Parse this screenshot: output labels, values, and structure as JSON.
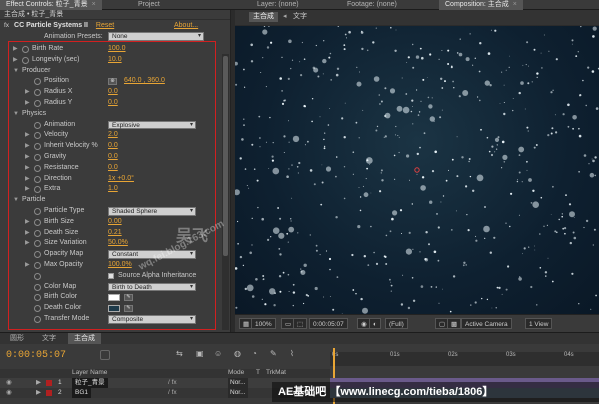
{
  "top_tabs": {
    "effect_controls": "Effect Controls: 粒子_青景",
    "project": "Project",
    "layer": "Layer: (none)",
    "footage": "Footage: (none)",
    "composition": "Composition: 主合成"
  },
  "ec": {
    "breadcrumb": "主合成 • 粒子_青景",
    "effect_name": "CC Particle Systems II",
    "reset": "Reset",
    "about": "About...",
    "presets_label": "Animation Presets:",
    "presets_value": "None",
    "rows": [
      {
        "label": "Birth Rate",
        "value": "100.0",
        "kind": "val",
        "indent": 1,
        "twirl": true,
        "sw": true
      },
      {
        "label": "Longevity (sec)",
        "value": "10.0",
        "kind": "val",
        "indent": 1,
        "twirl": true,
        "sw": true
      },
      {
        "label": "Producer",
        "kind": "group",
        "indent": 1
      },
      {
        "label": "Position",
        "value": "640.0 , 360.0",
        "kind": "pos",
        "indent": 2,
        "sw": true
      },
      {
        "label": "Radius X",
        "value": "0.0",
        "kind": "val",
        "indent": 2,
        "twirl": true,
        "sw": true
      },
      {
        "label": "Radius Y",
        "value": "0.0",
        "kind": "val",
        "indent": 2,
        "twirl": true,
        "sw": true
      },
      {
        "label": "Physics",
        "kind": "group",
        "indent": 1
      },
      {
        "label": "Animation",
        "value": "Explosive",
        "kind": "dd",
        "indent": 2,
        "sw": true
      },
      {
        "label": "Velocity",
        "value": "2.0",
        "kind": "val",
        "indent": 2,
        "twirl": true,
        "sw": true
      },
      {
        "label": "Inherit Velocity %",
        "value": "0.0",
        "kind": "val",
        "indent": 2,
        "twirl": true,
        "sw": true
      },
      {
        "label": "Gravity",
        "value": "0.0",
        "kind": "val",
        "indent": 2,
        "twirl": true,
        "sw": true
      },
      {
        "label": "Resistance",
        "value": "0.0",
        "kind": "val",
        "indent": 2,
        "twirl": true,
        "sw": true
      },
      {
        "label": "Direction",
        "value": "1x +0.0°",
        "kind": "val",
        "indent": 2,
        "twirl": true,
        "sw": true
      },
      {
        "label": "Extra",
        "value": "1.0",
        "kind": "val",
        "indent": 2,
        "twirl": true,
        "sw": true
      },
      {
        "label": "Particle",
        "kind": "group",
        "indent": 1
      },
      {
        "label": "Particle Type",
        "value": "Shaded Sphere",
        "kind": "dd",
        "indent": 2,
        "sw": true
      },
      {
        "label": "Birth Size",
        "value": "0.00",
        "kind": "val",
        "indent": 2,
        "twirl": true,
        "sw": true
      },
      {
        "label": "Death Size",
        "value": "0.21",
        "kind": "val",
        "indent": 2,
        "twirl": true,
        "sw": true
      },
      {
        "label": "Size Variation",
        "value": "50.0%",
        "kind": "val",
        "indent": 2,
        "twirl": true,
        "sw": true
      },
      {
        "label": "Opacity Map",
        "value": "Constant",
        "kind": "dd",
        "indent": 2,
        "sw": true
      },
      {
        "label": "Max Opacity",
        "value": "100.0%",
        "kind": "val",
        "indent": 2,
        "twirl": true,
        "sw": true
      },
      {
        "label": "",
        "value": "Source Alpha Inheritance",
        "kind": "chk",
        "indent": 2,
        "sw": true
      },
      {
        "label": "Color Map",
        "value": "Birth to Death",
        "kind": "dd",
        "indent": 2,
        "sw": true
      },
      {
        "label": "Birth Color",
        "value": "",
        "kind": "color",
        "color": "#ffffff",
        "indent": 2,
        "sw": true
      },
      {
        "label": "Death Color",
        "value": "",
        "kind": "color",
        "color": "#1e3a4a",
        "indent": 2,
        "sw": true
      },
      {
        "label": "Transfer Mode",
        "value": "Composite",
        "kind": "dd",
        "indent": 2,
        "sw": true
      }
    ]
  },
  "viewer": {
    "tab_main": "主合成",
    "tab_text": "文字",
    "zoom": "100%",
    "timecode": "0:00:05:07",
    "resolution": "(Full)",
    "camera": "Active Camera",
    "view": "1 View"
  },
  "timeline": {
    "tabs": [
      "圆形",
      "文字",
      "主合成"
    ],
    "timecode": "0:00:05:07",
    "col_layer_name": "Layer Name",
    "col_mode": "Mode",
    "col_t": "T",
    "col_trkmat": "TrkMat",
    "ruler": [
      "0s",
      "01s",
      "02s",
      "03s",
      "04s"
    ],
    "layers": [
      {
        "num": "1",
        "name": "粒子_青景",
        "mode": "Nor...",
        "color": "#b02020"
      },
      {
        "num": "2",
        "name": "BG1",
        "mode": "Nor...",
        "trkmat": "None",
        "color": "#b02020"
      }
    ]
  },
  "watermarks": {
    "banner": "AE基础吧 【www.linecg.com/tieba/1806】",
    "diag": "wq.fei.blog.163.com",
    "big": "吴飞"
  },
  "colors": {
    "accent": "#e8a535",
    "highlight_box": "#d12020",
    "bg": "#3b3b3b"
  }
}
